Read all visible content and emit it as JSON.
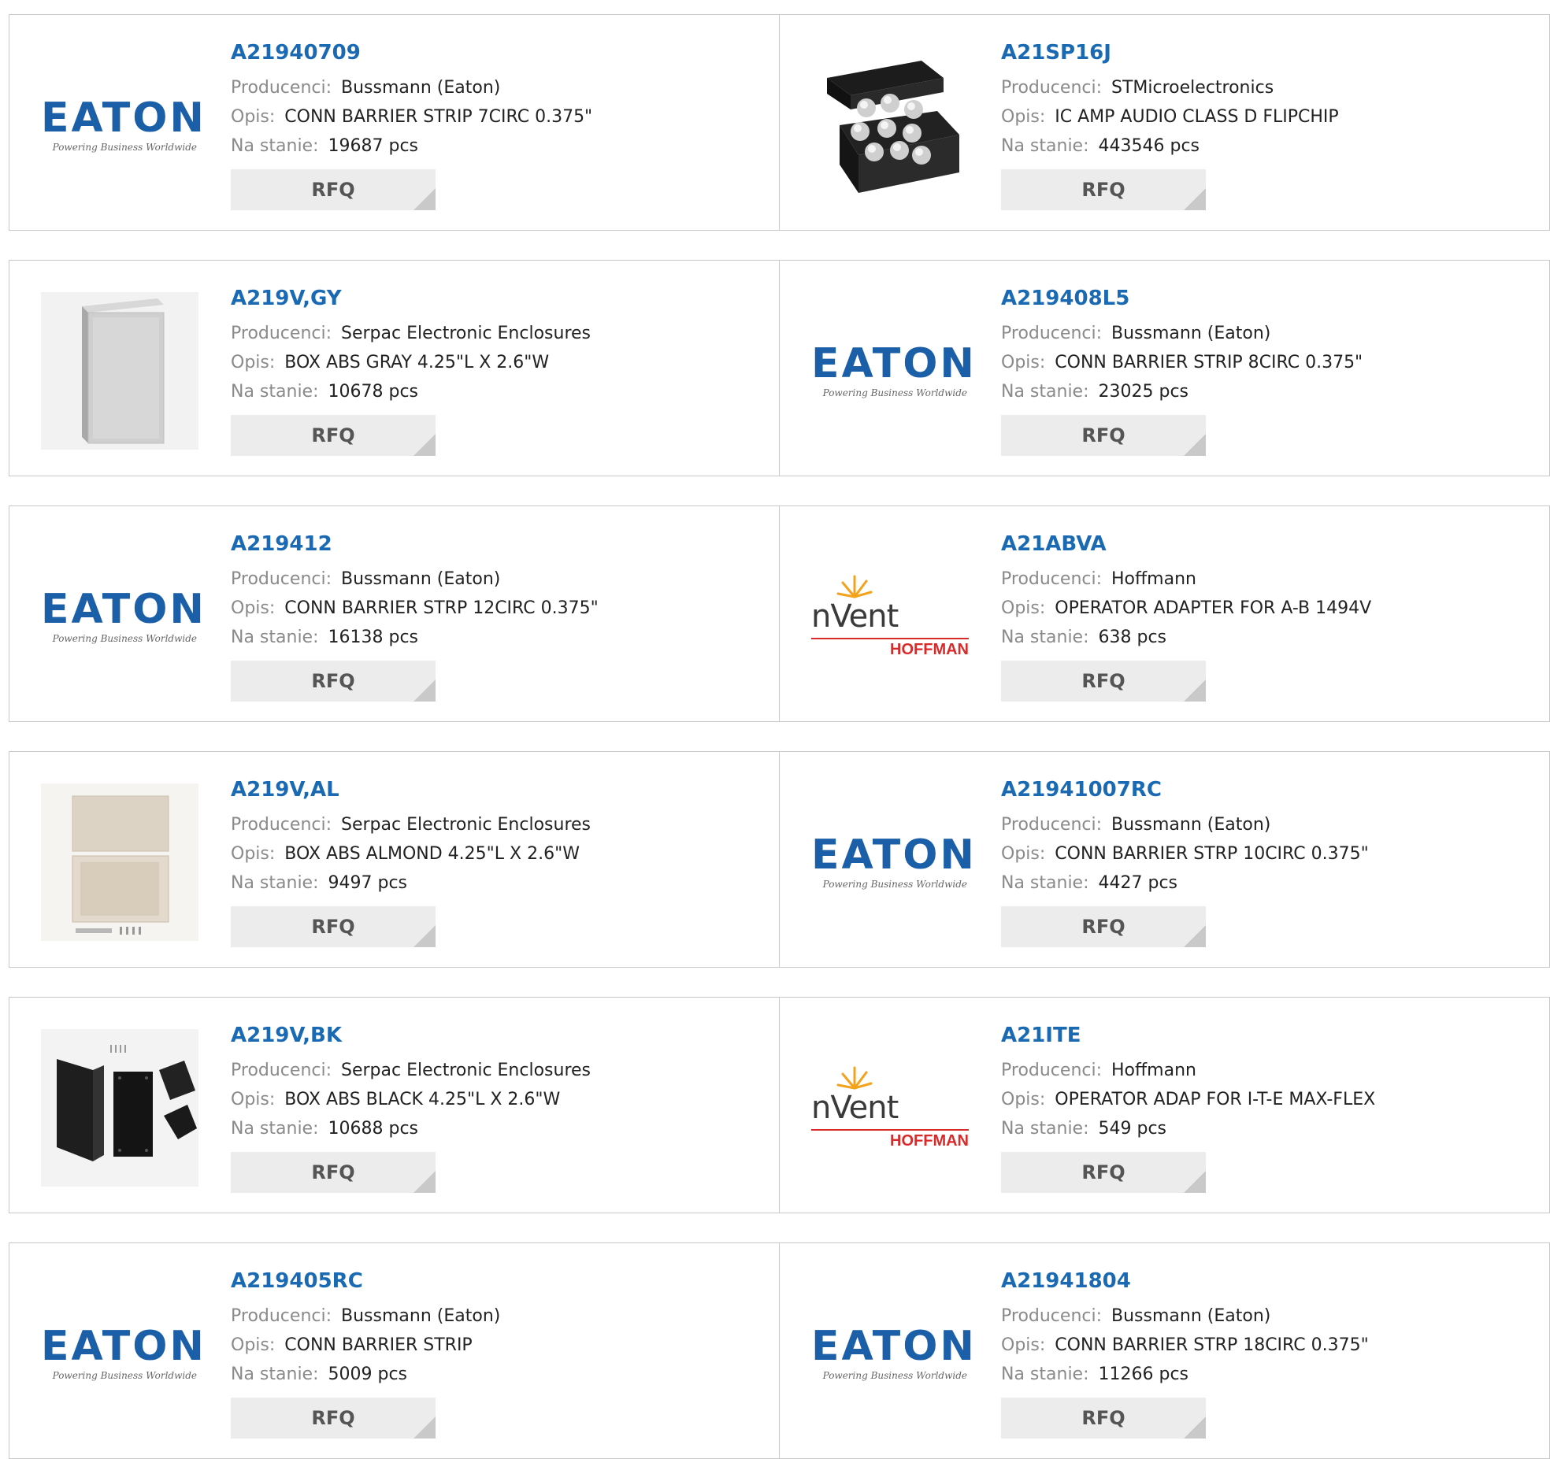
{
  "labels": {
    "manufacturer": "Producenci:",
    "description": "Opis:",
    "stock": "Na stanie:",
    "rfq": "RFQ"
  },
  "brand_colors": {
    "part_link": "#1a6ab3",
    "eaton_blue": "#1b5fa8",
    "hoffman_red": "#d92a2a"
  },
  "logos": {
    "eaton": {
      "word": "EATON",
      "tagline": "Powering Business Worldwide"
    },
    "nvent": {
      "word": "nVent",
      "sub": "HOFFMAN"
    }
  },
  "products": [
    {
      "part": "A21940709",
      "manufacturer": "Bussmann (Eaton)",
      "description": "CONN BARRIER STRIP 7CIRC 0.375\"",
      "stock": "19687 pcs",
      "image": "eaton-logo"
    },
    {
      "part": "A21SP16J",
      "manufacturer": "STMicroelectronics",
      "description": "IC AMP AUDIO CLASS D FLIPCHIP",
      "stock": "443546 pcs",
      "image": "flipchip-photo"
    },
    {
      "part": "A219V,GY",
      "manufacturer": "Serpac Electronic Enclosures",
      "description": "BOX ABS GRAY 4.25\"L X 2.6\"W",
      "stock": "10678 pcs",
      "image": "gray-box-photo"
    },
    {
      "part": "A219408L5",
      "manufacturer": "Bussmann (Eaton)",
      "description": "CONN BARRIER STRIP 8CIRC 0.375\"",
      "stock": "23025 pcs",
      "image": "eaton-logo"
    },
    {
      "part": "A219412",
      "manufacturer": "Bussmann (Eaton)",
      "description": "CONN BARRIER STRP 12CIRC 0.375\"",
      "stock": "16138 pcs",
      "image": "eaton-logo"
    },
    {
      "part": "A21ABVA",
      "manufacturer": "Hoffmann",
      "description": "OPERATOR ADAPTER FOR A-B 1494V",
      "stock": "638 pcs",
      "image": "nvent-logo"
    },
    {
      "part": "A219V,AL",
      "manufacturer": "Serpac Electronic Enclosures",
      "description": "BOX ABS ALMOND 4.25\"L X 2.6\"W",
      "stock": "9497 pcs",
      "image": "almond-box-photo"
    },
    {
      "part": "A21941007RC",
      "manufacturer": "Bussmann (Eaton)",
      "description": "CONN BARRIER STRP 10CIRC 0.375\"",
      "stock": "4427 pcs",
      "image": "eaton-logo"
    },
    {
      "part": "A219V,BK",
      "manufacturer": "Serpac Electronic Enclosures",
      "description": "BOX ABS BLACK 4.25\"L X 2.6\"W",
      "stock": "10688 pcs",
      "image": "black-box-photo"
    },
    {
      "part": "A21ITE",
      "manufacturer": "Hoffmann",
      "description": "OPERATOR ADAP FOR I-T-E MAX-FLEX",
      "stock": "549 pcs",
      "image": "nvent-logo"
    },
    {
      "part": "A219405RC",
      "manufacturer": "Bussmann (Eaton)",
      "description": "CONN BARRIER STRIP",
      "stock": "5009 pcs",
      "image": "eaton-logo"
    },
    {
      "part": "A21941804",
      "manufacturer": "Bussmann (Eaton)",
      "description": "CONN BARRIER STRP 18CIRC 0.375\"",
      "stock": "11266 pcs",
      "image": "eaton-logo"
    }
  ]
}
